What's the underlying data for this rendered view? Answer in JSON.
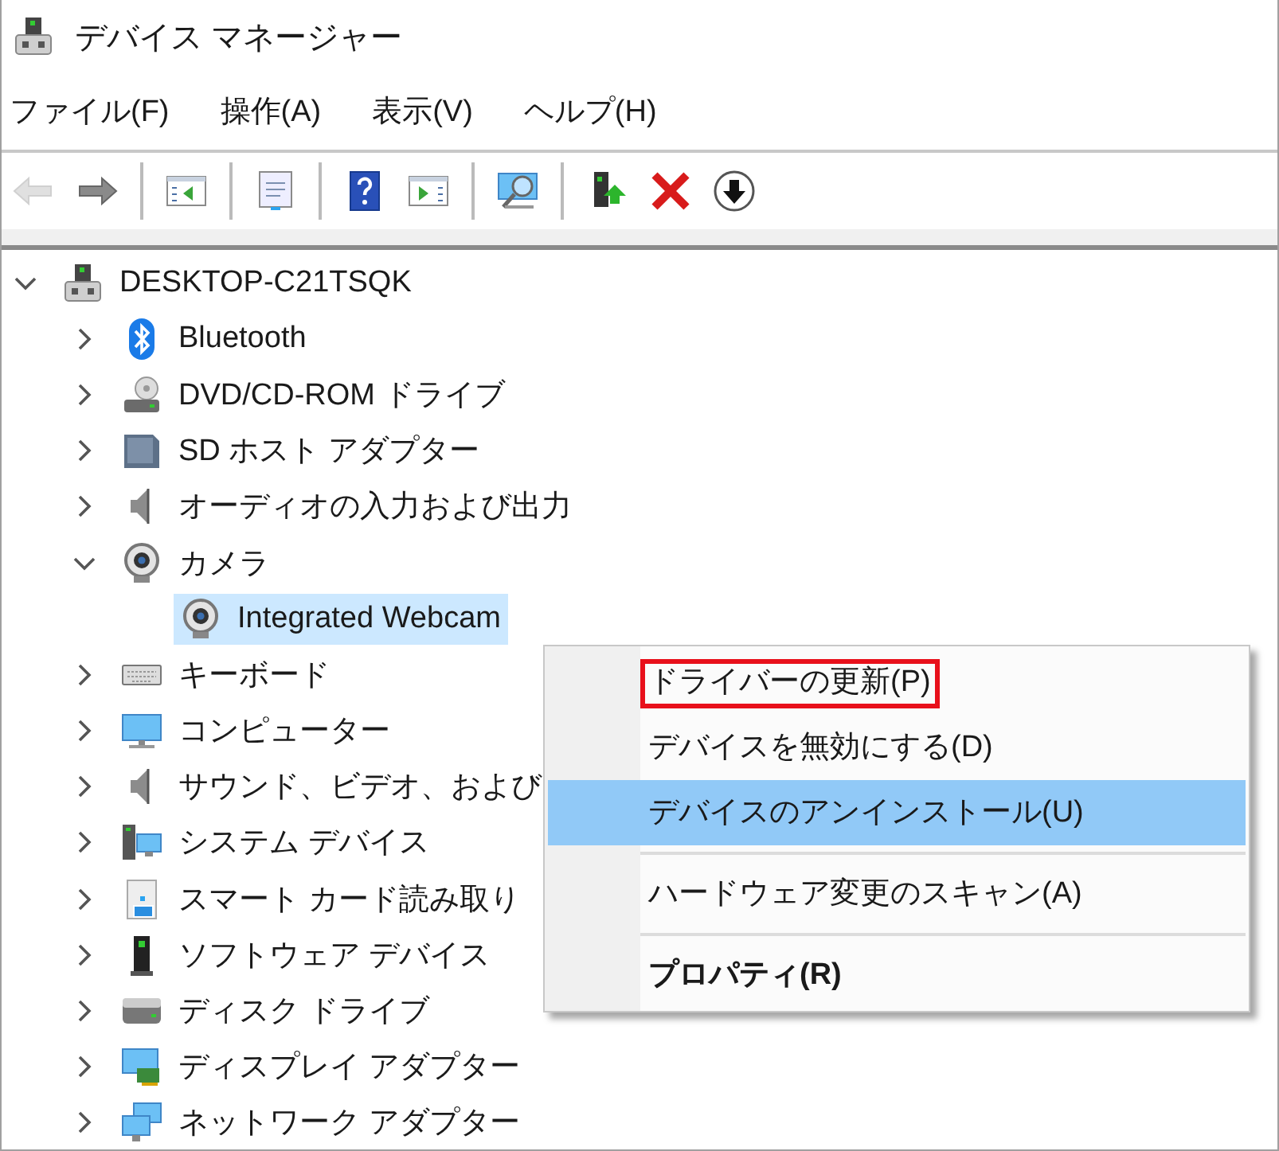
{
  "window": {
    "title": "デバイス マネージャー"
  },
  "menu_bar": [
    "ファイル(F)",
    "操作(A)",
    "表示(V)",
    "ヘルプ(H)"
  ],
  "toolbar": [
    [
      {
        "kind": "back",
        "disabled": true
      },
      {
        "kind": "forward",
        "disabled": false
      }
    ],
    [
      {
        "kind": "console-tree",
        "disabled": false
      }
    ],
    [
      {
        "kind": "properties",
        "disabled": false
      }
    ],
    [
      {
        "kind": "help",
        "disabled": false
      },
      {
        "kind": "action-pane",
        "disabled": false
      }
    ],
    [
      {
        "kind": "scan",
        "disabled": false
      }
    ],
    [
      {
        "kind": "update-driver",
        "disabled": false
      },
      {
        "kind": "uninstall",
        "disabled": false
      },
      {
        "kind": "disable",
        "disabled": false
      }
    ]
  ],
  "tree": [
    {
      "label": "DESKTOP-C21TSQK",
      "kind": "computer",
      "expanded": true,
      "selected": false,
      "children": [
        {
          "label": "Bluetooth",
          "kind": "bluetooth",
          "expanded": false,
          "selected": false
        },
        {
          "label": "DVD/CD-ROM ドライブ",
          "kind": "dvd",
          "expanded": false,
          "selected": false
        },
        {
          "label": "SD ホスト アダプター",
          "kind": "sd",
          "expanded": false,
          "selected": false
        },
        {
          "label": "オーディオの入力および出力",
          "kind": "speaker",
          "expanded": false,
          "selected": false
        },
        {
          "label": "カメラ",
          "kind": "webcam",
          "expanded": true,
          "selected": false,
          "children": [
            {
              "label": "Integrated Webcam",
              "kind": "webcam",
              "selected": true
            }
          ]
        },
        {
          "label": "キーボード",
          "kind": "keyboard",
          "expanded": false,
          "selected": false
        },
        {
          "label": "コンピューター",
          "kind": "monitor",
          "expanded": false,
          "selected": false
        },
        {
          "label": "サウンド、ビデオ、および",
          "kind": "speaker",
          "expanded": false,
          "selected": false
        },
        {
          "label": "システム デバイス",
          "kind": "system",
          "expanded": false,
          "selected": false
        },
        {
          "label": "スマート カード読み取り",
          "kind": "smartcard",
          "expanded": false,
          "selected": false
        },
        {
          "label": "ソフトウェア デバイス",
          "kind": "software",
          "expanded": false,
          "selected": false
        },
        {
          "label": "ディスク ドライブ",
          "kind": "disk",
          "expanded": false,
          "selected": false
        },
        {
          "label": "ディスプレイ アダプター",
          "kind": "display",
          "expanded": false,
          "selected": false
        },
        {
          "label": "ネットワーク アダプター",
          "kind": "network",
          "expanded": false,
          "selected": false
        }
      ]
    }
  ],
  "context_menu": {
    "items": [
      {
        "kind": "command",
        "label": "ドライバーの更新(P)",
        "selected": false,
        "default": false,
        "annotated": true
      },
      {
        "kind": "command",
        "label": "デバイスを無効にする(D)",
        "selected": false,
        "default": false,
        "annotated": false
      },
      {
        "kind": "command",
        "label": "デバイスのアンインストール(U)",
        "selected": true,
        "default": false,
        "annotated": false
      },
      {
        "kind": "separator"
      },
      {
        "kind": "command",
        "label": "ハードウェア変更のスキャン(A)",
        "selected": false,
        "default": false,
        "annotated": false
      },
      {
        "kind": "separator"
      },
      {
        "kind": "command",
        "label": "プロパティ(R)",
        "selected": false,
        "default": true,
        "annotated": false
      }
    ]
  }
}
